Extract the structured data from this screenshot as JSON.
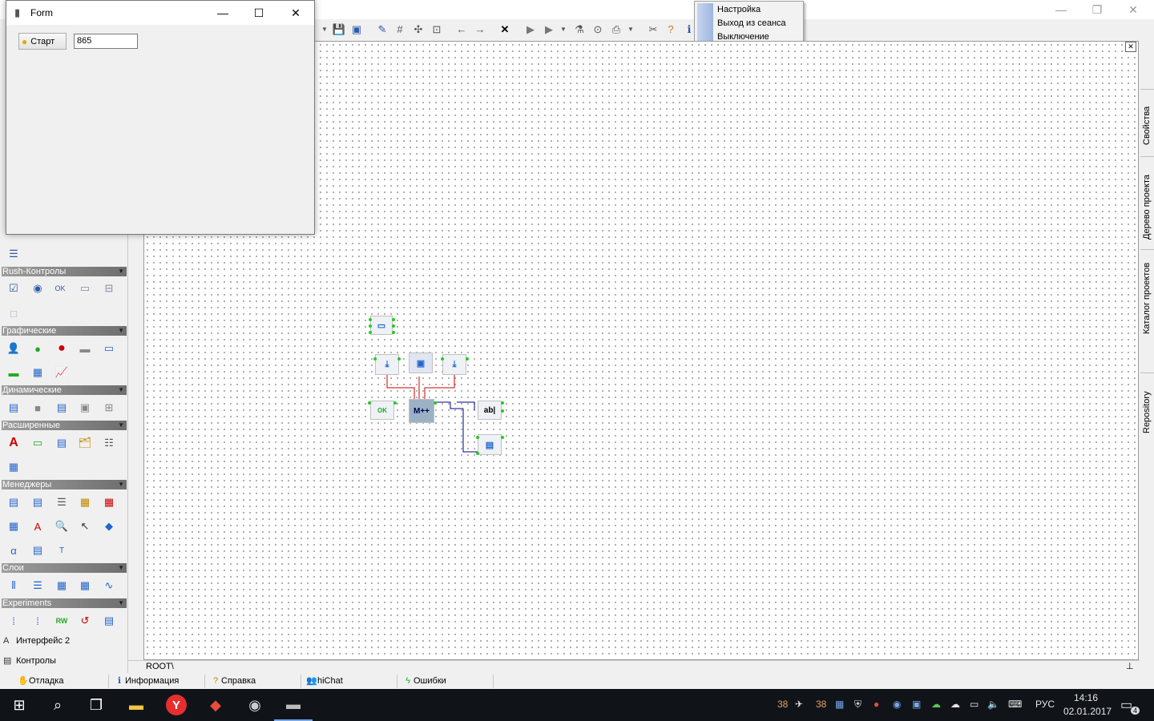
{
  "form_window": {
    "title": "Form",
    "start_button_label": "Старт",
    "value_field": "865"
  },
  "popup_menu": {
    "items": [
      "Настройка",
      "Выход из сеанса",
      "Выключение"
    ]
  },
  "palette": {
    "groups": [
      "Rush-Контролы",
      "Графические",
      "Динамические",
      "Расширенные",
      "Менеджеры",
      "Слои",
      "Experiments"
    ],
    "bottom_items": [
      "Интерфейс 2",
      "Контролы"
    ]
  },
  "design": {
    "path": "ROOT\\",
    "components": [
      "form-component",
      "button-ok-component",
      "counter-component",
      "edit-component",
      "memo-component"
    ]
  },
  "right_tabs": [
    "Свойства",
    "Дерево проекта",
    "Каталог проектов",
    "Repository"
  ],
  "bottom_tabs": [
    "Отладка",
    "Информация",
    "Справка",
    "hiChat",
    "Ошибки"
  ],
  "taskbar": {
    "tray_numbers": [
      "38",
      "38"
    ],
    "language": "РУС",
    "time": "14:16",
    "date": "02.01.2017",
    "notifications": "4"
  },
  "colors": {
    "selection_handle": "#22cc22",
    "link_red": "#cc0000",
    "link_blue": "#000080",
    "taskbar": "#101419"
  }
}
